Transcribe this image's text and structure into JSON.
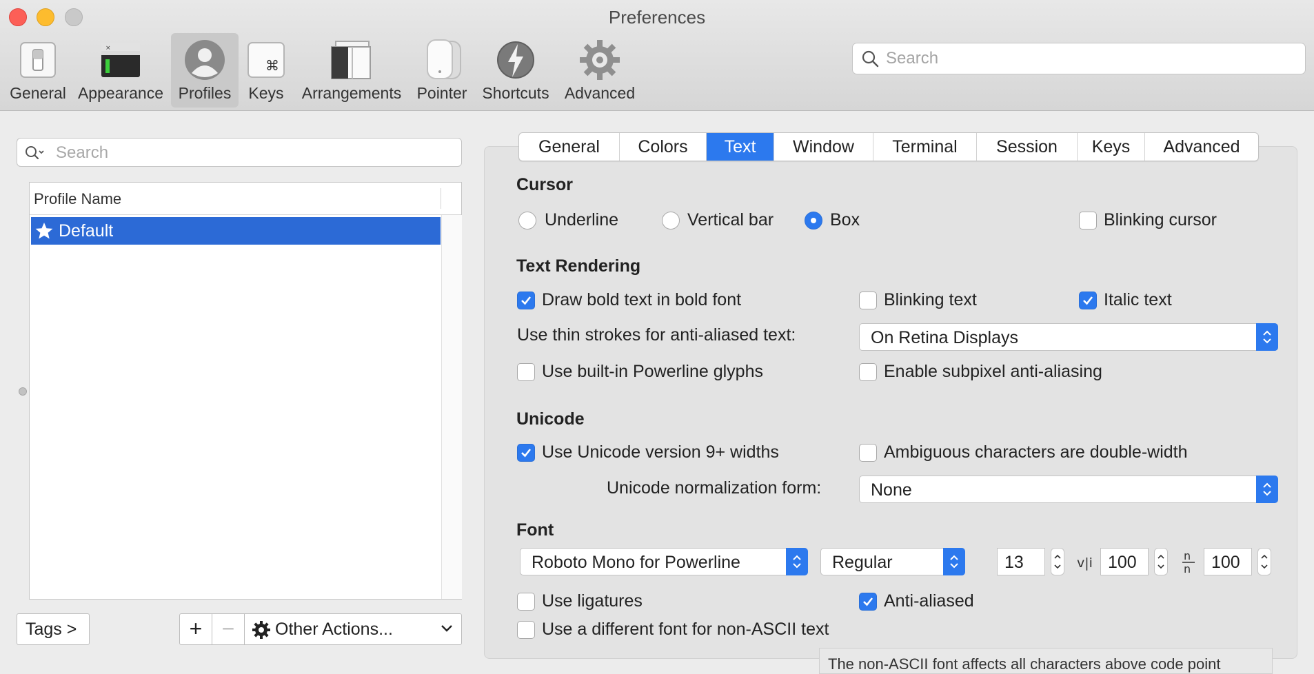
{
  "window": {
    "title": "Preferences"
  },
  "toolbar": {
    "items": [
      {
        "label": "General",
        "icon": "general-switch-icon"
      },
      {
        "label": "Appearance",
        "icon": "appearance-terminal-icon"
      },
      {
        "label": "Profiles",
        "icon": "profiles-person-icon",
        "selected": true
      },
      {
        "label": "Keys",
        "icon": "keys-command-icon"
      },
      {
        "label": "Arrangements",
        "icon": "arrangements-windows-icon"
      },
      {
        "label": "Pointer",
        "icon": "pointer-mouse-icon"
      },
      {
        "label": "Shortcuts",
        "icon": "shortcuts-bolt-icon"
      },
      {
        "label": "Advanced",
        "icon": "advanced-gear-icon"
      }
    ],
    "search_placeholder": "Search"
  },
  "profiles": {
    "search_placeholder": "Search",
    "column_header": "Profile Name",
    "items": [
      {
        "name": "Default",
        "icon": "star-icon",
        "selected": true
      }
    ],
    "tags_button": "Tags >",
    "add_button": "+",
    "remove_button": "−",
    "other_actions_button": "Other Actions..."
  },
  "tabs": {
    "items": [
      "General",
      "Colors",
      "Text",
      "Window",
      "Terminal",
      "Session",
      "Keys",
      "Advanced"
    ],
    "active": "Text"
  },
  "cursor": {
    "heading": "Cursor",
    "options": [
      "Underline",
      "Vertical bar",
      "Box"
    ],
    "selected": "Box",
    "blinking_label": "Blinking cursor",
    "blinking_checked": false
  },
  "rendering": {
    "heading": "Text Rendering",
    "draw_bold_label": "Draw bold text in bold font",
    "draw_bold_checked": true,
    "blinking_text_label": "Blinking text",
    "blinking_text_checked": false,
    "italic_label": "Italic text",
    "italic_checked": true,
    "thin_strokes_label": "Use thin strokes for anti-aliased text:",
    "thin_strokes_value": "On Retina Displays",
    "powerline_label": "Use built-in Powerline glyphs",
    "powerline_checked": false,
    "subpixel_label": "Enable subpixel anti-aliasing",
    "subpixel_checked": false
  },
  "unicode": {
    "heading": "Unicode",
    "v9_label": "Use Unicode version 9+ widths",
    "v9_checked": true,
    "ambiguous_label": "Ambiguous characters are double-width",
    "ambiguous_checked": false,
    "normalization_label": "Unicode normalization form:",
    "normalization_value": "None"
  },
  "font": {
    "heading": "Font",
    "family": "Roboto Mono for Powerline",
    "weight": "Regular",
    "size": "13",
    "vertical_spacing_icon": "v|i",
    "vertical_spacing": "100",
    "horizontal_spacing_icon": "n/n",
    "horizontal_spacing": "100",
    "ligatures_label": "Use ligatures",
    "ligatures_checked": false,
    "antialiased_label": "Anti-aliased",
    "antialiased_checked": true,
    "non_ascii_label": "Use a different font for non-ASCII text",
    "non_ascii_checked": false
  },
  "tooltip": {
    "text": "The non-ASCII font affects all characters above code point"
  },
  "colors": {
    "accent": "#2c79ee",
    "selection": "#2c6ad6"
  }
}
